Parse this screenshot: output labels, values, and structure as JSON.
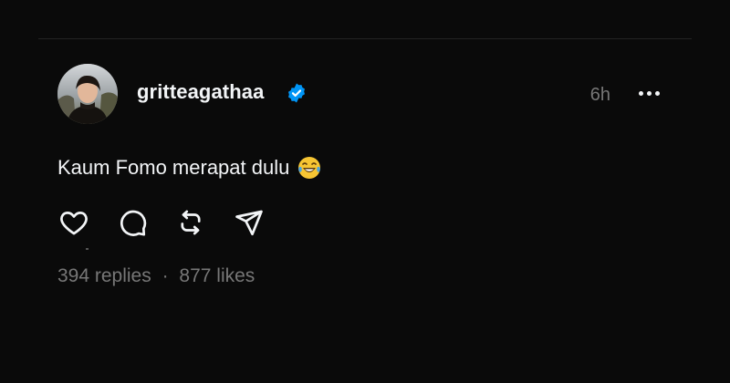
{
  "post": {
    "username": "gritteagathaa",
    "verified": true,
    "timestamp": "6h",
    "text": "Kaum Fomo merapat dulu",
    "emoji": "face-with-tears-of-joy",
    "replies": "394 replies",
    "separator": "·",
    "likes": "877 likes"
  },
  "icons": {
    "more": "more-horizontal-icon",
    "like": "heart-icon",
    "reply": "comment-icon",
    "repost": "repost-icon",
    "share": "send-icon",
    "verified": "verified-badge-icon"
  },
  "colors": {
    "background": "#0a0a0a",
    "text": "#f3f5f7",
    "muted": "#777777",
    "verified": "#0095f6"
  }
}
